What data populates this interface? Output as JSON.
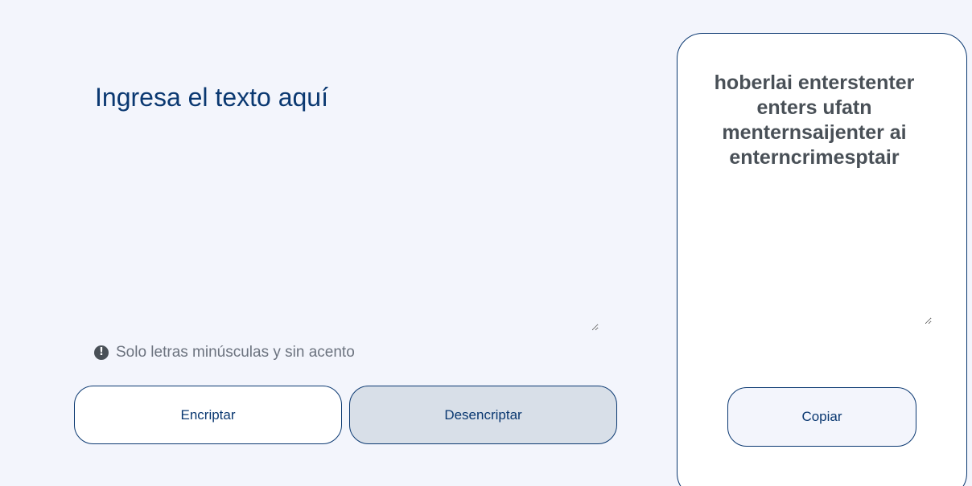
{
  "input": {
    "placeholder": "Ingresa el texto aquí",
    "value": ""
  },
  "hint": {
    "icon": "exclamation-circle-icon",
    "text": "Solo letras minúsculas y sin acento"
  },
  "buttons": {
    "encrypt_label": "Encriptar",
    "decrypt_label": "Desencriptar",
    "copy_label": "Copiar"
  },
  "output": {
    "text": "hoberlai enterstenter enters ufatn menternsaijenter ai enterncrimesptair"
  },
  "colors": {
    "background": "#f3f5fc",
    "accent": "#0a3871",
    "secondary_button": "#d8dfe8",
    "output_text": "#495057",
    "hint_text": "#6c737f"
  }
}
